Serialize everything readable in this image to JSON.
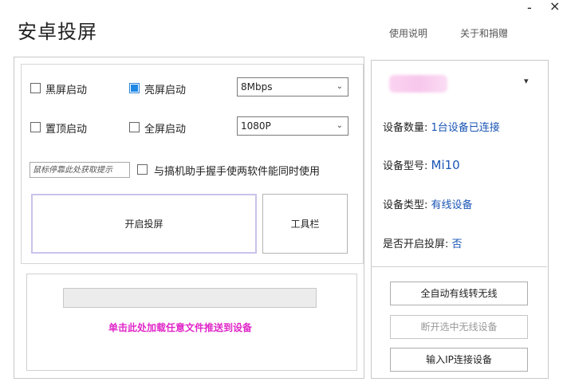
{
  "app": {
    "title": "安卓投屏",
    "links": [
      "使用说明",
      "关于和捐赠"
    ],
    "minimize_glyph": "-",
    "close_glyph": "×"
  },
  "options": {
    "black_screen": {
      "label": "黑屏启动",
      "checked": false
    },
    "bright_screen": {
      "label": "亮屏启动",
      "checked": true
    },
    "bitrate": "8Mbps",
    "top_most": {
      "label": "置顶启动",
      "checked": false
    },
    "fullscreen": {
      "label": "全屏启动",
      "checked": false
    },
    "resolution": "1080P",
    "mouse_hint_placeholder": "鼠标停靠此处获取提示",
    "coexist": {
      "label": "与搞机助手握手使两软件能同时使用",
      "checked": false
    }
  },
  "buttons": {
    "start_cast": "开启投屏",
    "toolbar": "工具栏",
    "auto_wireless": "全自动有线转无线",
    "disconnect_wireless": "断开选中无线设备",
    "ip_connect": "输入IP连接设备"
  },
  "upload": {
    "text": "单击此处加载任意文件推送到设备"
  },
  "device": {
    "selector_arrow": "▾",
    "count_label": "设备数量:",
    "count_value": "1台设备已连接",
    "model_label": "设备型号:",
    "model_value": "Mi10",
    "type_label": "设备类型:",
    "type_value": "有线设备",
    "casting_label": "是否开启投屏:",
    "casting_value": "否"
  },
  "colors": {
    "accent": "#1e88e5",
    "link_value": "#1a56b5",
    "upload_text": "#e027c8",
    "button_border_active": "#b9b3e3"
  }
}
